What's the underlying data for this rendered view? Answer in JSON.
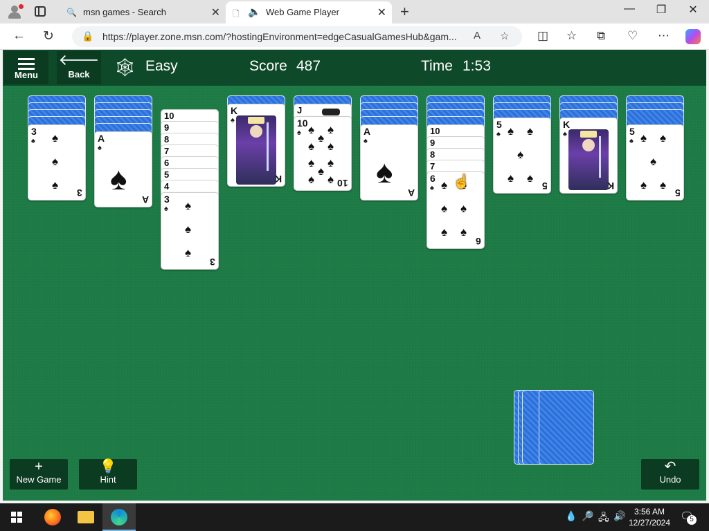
{
  "browser": {
    "tabs": [
      {
        "title": "msn games - Search",
        "active": false
      },
      {
        "title": "Web Game Player",
        "active": true
      }
    ],
    "url": "https://player.zone.msn.com/?hostingEnvironment=edgeCasualGamesHub&gam..."
  },
  "game": {
    "menu_label": "Menu",
    "back_label": "Back",
    "difficulty": "Easy",
    "score_label": "Score",
    "score_value": "487",
    "time_label": "Time",
    "time_value": "1:53",
    "new_game_label": "New Game",
    "hint_label": "Hint",
    "undo_label": "Undo",
    "felt_color": "#1d7a45",
    "columns": [
      {
        "face_down": 4,
        "face_up": [
          "3"
        ]
      },
      {
        "face_down": 5,
        "face_up": [
          "A"
        ]
      },
      {
        "face_down": 0,
        "face_up": [
          "10",
          "9",
          "8",
          "7",
          "6",
          "5",
          "4",
          "3"
        ]
      },
      {
        "face_down": 1,
        "face_up": [
          "K"
        ]
      },
      {
        "face_down": 1,
        "face_up": [
          "J",
          "10"
        ]
      },
      {
        "face_down": 4,
        "face_up": [
          "A"
        ]
      },
      {
        "face_down": 4,
        "face_up": [
          "10",
          "9",
          "8",
          "7",
          "6"
        ]
      },
      {
        "face_down": 3,
        "face_up": [
          "5"
        ]
      },
      {
        "face_down": 3,
        "face_up": [
          "K"
        ]
      },
      {
        "face_down": 3,
        "face_up": [
          "5"
        ]
      }
    ],
    "suit": "♠",
    "stock_piles": 4
  },
  "taskbar": {
    "time": "3:56 AM",
    "date": "12/27/2024",
    "notifications": "5"
  }
}
